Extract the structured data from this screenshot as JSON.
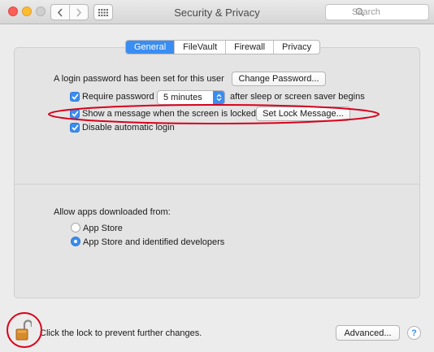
{
  "window": {
    "title": "Security & Privacy"
  },
  "toolbar": {
    "search_placeholder": "Search"
  },
  "tabs": [
    {
      "label": "General",
      "active": true
    },
    {
      "label": "FileVault",
      "active": false
    },
    {
      "label": "Firewall",
      "active": false
    },
    {
      "label": "Privacy",
      "active": false
    }
  ],
  "general": {
    "login_password_text": "A login password has been set for this user",
    "change_password_label": "Change Password...",
    "require_password_label": "Require password",
    "require_password_checked": true,
    "require_password_value": "5 minutes",
    "after_sleep_text": "after sleep or screen saver begins",
    "show_message_label": "Show a message when the screen is locked",
    "show_message_checked": true,
    "set_lock_message_label": "Set Lock Message...",
    "disable_auto_login_label": "Disable automatic login",
    "disable_auto_login_checked": true
  },
  "allow_apps": {
    "heading": "Allow apps downloaded from:",
    "options": [
      {
        "label": "App Store",
        "selected": false
      },
      {
        "label": "App Store and identified developers",
        "selected": true
      }
    ]
  },
  "footer": {
    "lock_text": "Click the lock to prevent further changes.",
    "advanced_label": "Advanced...",
    "help_label": "?"
  },
  "colors": {
    "accent": "#3a8df2",
    "annotation": "#d9001b",
    "close": "#fc5f57",
    "minimize": "#fdbc2e",
    "lock": "#d68a2a"
  }
}
